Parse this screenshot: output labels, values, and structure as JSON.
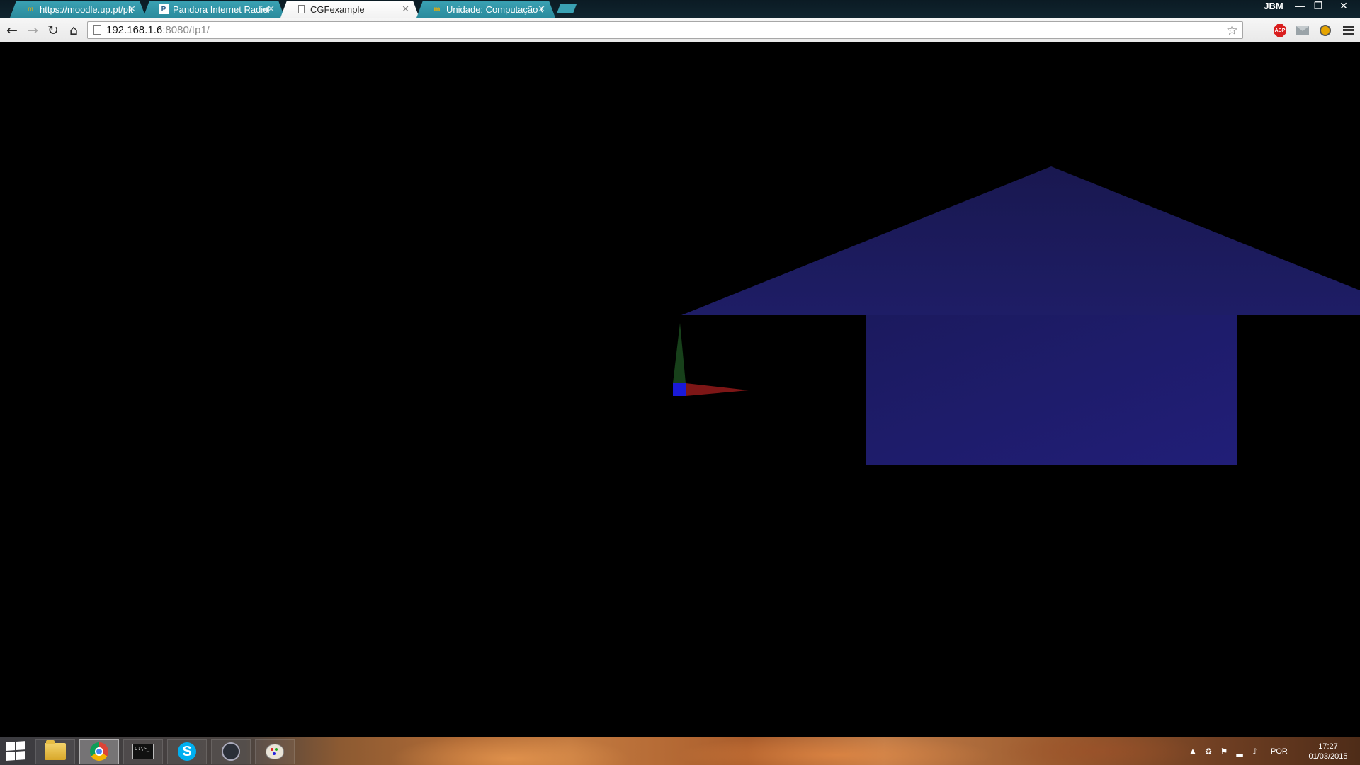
{
  "browser": {
    "tabs": [
      {
        "label": "https://moodle.up.pt/plu",
        "icon": "moodle-favicon",
        "active": false
      },
      {
        "label": "Pandora Internet Radio",
        "icon": "pandora-favicon",
        "active": false
      },
      {
        "label": "CGFexample",
        "icon": "page-favicon",
        "active": true
      },
      {
        "label": "Unidade: Computação Gr",
        "icon": "moodle-favicon",
        "active": false
      }
    ],
    "user_badge": "JBM",
    "window_controls": {
      "minimize": "—",
      "restore": "❐",
      "close": "✕"
    },
    "toolbar": {
      "back_icon": "←",
      "forward_icon": "→",
      "reload_icon": "↻",
      "home_icon": "⌂"
    },
    "address": {
      "host": "192.168.1.6",
      "rest": ":8080/tp1/"
    },
    "extensions": [
      "adblock-plus-icon",
      "mail-icon",
      "hat-icon"
    ],
    "abp_label": "ABP"
  },
  "scene": {
    "background": "#000000",
    "roof_color": "#1c1b62",
    "wall_color": "#1f1c72",
    "axes": {
      "x_color": "#7d1616",
      "y_color": "#17401a",
      "z_color": "#1a1ad8"
    }
  },
  "taskbar": {
    "apps": [
      "file-explorer",
      "chrome",
      "command-prompt",
      "skype",
      "steam",
      "paint"
    ],
    "cmd_text": "C:\\>_",
    "skype_letter": "S",
    "tray": {
      "show_hidden": "▲",
      "language": "POR",
      "time": "17:27",
      "date": "01/03/2015"
    }
  }
}
